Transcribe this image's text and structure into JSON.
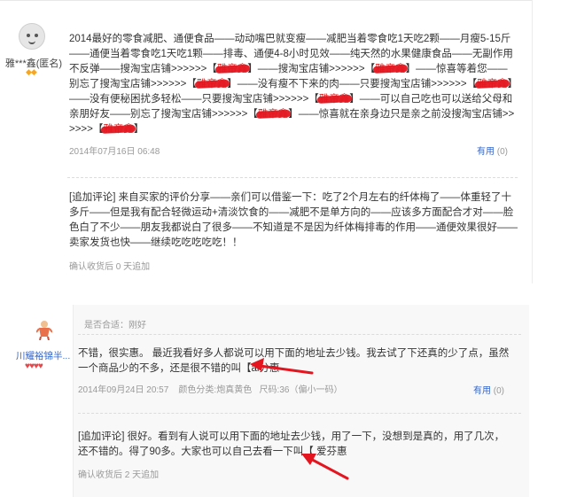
{
  "review1": {
    "user": {
      "name": "雅***鑫(匿名)",
      "stars": "◆◆"
    },
    "body": [
      {
        "t": "2014最好的零食减肥、通便食品——动动嘴巴就变瘦——减肥当着零食吃1天吃2颗——月瘦5-15斤——通便当着零食吃1天吃1颗——排毒、通便4-8小时见效——纯天然的水果健康食品——无副作用不反弹——搜淘宝店铺>>>>>>【"
      },
      {
        "t": "雅帝鑫",
        "s": true
      },
      {
        "t": "】——搜淘宝店铺>>>>>>【"
      },
      {
        "t": "雅帝鑫",
        "s": true
      },
      {
        "t": "】——惊喜等着您——别忘了搜淘宝店铺>>>>>>【"
      },
      {
        "t": "雅帝鑫",
        "s": true
      },
      {
        "t": "】——没有瘦不下来的肉——只要搜淘宝店铺>>>>>>【"
      },
      {
        "t": "雅帝鑫",
        "s": true
      },
      {
        "t": "】——没有便秘困扰多轻松——只要搜淘宝店铺>>>>>>【"
      },
      {
        "t": "雅帝鑫",
        "s": true
      },
      {
        "t": "】——可以自己吃也可以送给父母和亲朋好友——别忘了搜淘宝店铺>>>>>>【"
      },
      {
        "t": "雅帝鑫",
        "s": true
      },
      {
        "t": "】——惊喜就在亲身边只是亲之前没搜淘宝店铺>>>>>>【"
      },
      {
        "t": "雅帝鑫",
        "s": true
      },
      {
        "t": "】"
      }
    ],
    "date": "2014年07月16日 06:48",
    "useful_label": "有用",
    "useful_count": "(0)",
    "followup": "[追加评论] 来自买家的评价分享——亲们可以借鉴一下：吃了2个月左右的纤体梅了——体重轻了十多斤——但是我有配合轻微运动+清淡饮食的——减肥不是单方向的——应该多方面配合才对——脸色白了不少——朋友我都说白了很多——不知道是不是因为纤体梅排毒的作用——通便效果很好——卖家发货也快——继续吃吃吃吃吃！！",
    "followup_meta": "确认收货后 0 天追加"
  },
  "review2": {
    "user": {
      "name": "川耀裕锦半...",
      "stars": "♥♥♥♥"
    },
    "match": "是否合适：刚好",
    "body": "不错，很实惠。 最近我看好多人都说可以用下面的地址去少钱。我去试了下还真的少了点，虽然一个商品少的不多，还是很不错的叫【ai分惠",
    "date": "2014年09月24日 20:57",
    "color_label": "颜色分类:",
    "color_value": "炮真黄色",
    "size_label": "尺码:",
    "size_value": "36（偏小一码）",
    "useful_label": "有用",
    "useful_count": "(0)",
    "followup": "[追加评论] 很好。看到有人说可以用下面的地址去少钱，用了一下，没想到是真的，用了几次，还不错的。得了90多。大家也可以自己去看一下叫【 爱芬惠",
    "followup_meta": "确认收货后 2 天追加"
  },
  "colors": {
    "link": "#3366cc",
    "annotation_red": "#e4151f",
    "muted": "#999999"
  }
}
